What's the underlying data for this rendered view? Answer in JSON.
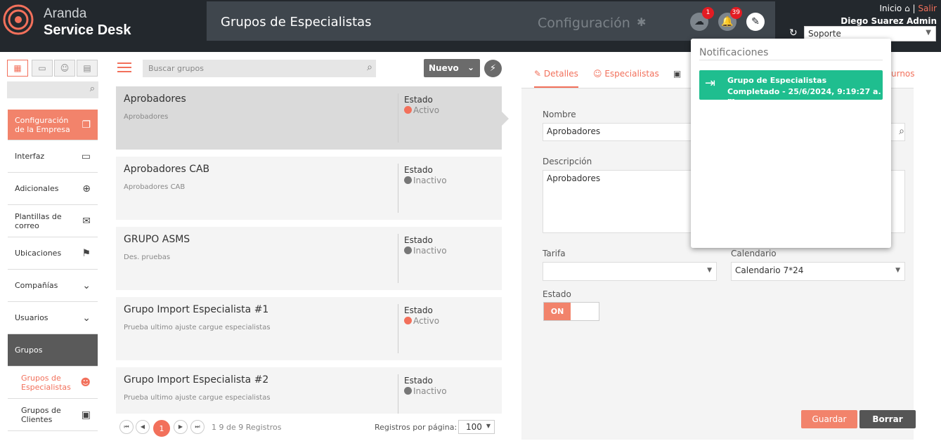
{
  "brand": {
    "line1": "Aranda",
    "line2": "Service Desk"
  },
  "header": {
    "title": "Grupos de Especialistas",
    "config_label": "Configuración",
    "upload_badge": "1",
    "notif_badge": "39"
  },
  "toplinks": {
    "inicio": "Inicio",
    "separator": "|",
    "salir": "Salir",
    "user": "Diego Suarez Admin",
    "project": "Soporte"
  },
  "sidebar": {
    "items": [
      {
        "label": "Configuración de la Empresa"
      },
      {
        "label": "Interfaz"
      },
      {
        "label": "Adicionales"
      },
      {
        "label": "Plantillas de correo"
      },
      {
        "label": "Ubicaciones"
      },
      {
        "label": "Compañías"
      },
      {
        "label": "Usuarios"
      },
      {
        "label": "Grupos"
      },
      {
        "label": "Grupos de Especialistas"
      },
      {
        "label": "Grupos de Clientes"
      }
    ]
  },
  "list": {
    "search_placeholder": "Buscar grupos",
    "new_label": "Nuevo",
    "status_label": "Estado",
    "cards": [
      {
        "name": "Aprobadores",
        "desc": "Aprobadores",
        "state": "Activo"
      },
      {
        "name": "Aprobadores CAB",
        "desc": "Aprobadores CAB",
        "state": "Inactivo"
      },
      {
        "name": "GRUPO ASMS",
        "desc": "Des. pruebas",
        "state": "Inactivo"
      },
      {
        "name": "Grupo Import Especialista #1",
        "desc": "Prueba ultimo ajuste cargue especialistas",
        "state": "Activo"
      },
      {
        "name": "Grupo Import Especialista #2",
        "desc": "Prueba ultimo ajuste cargue especialistas",
        "state": "Inactivo"
      }
    ]
  },
  "pager": {
    "current": "1",
    "range": "1 9 de 9 Registros",
    "per_page_label": "Registros por página:",
    "per_page": "100"
  },
  "detail": {
    "tabs": {
      "detalles": "Detalles",
      "especialistas": "Especialistas",
      "turnos": "urnos"
    },
    "nombre_label": "Nombre",
    "nombre_value": "Aprobadores",
    "descripcion_label": "Descripción",
    "descripcion_value": "Aprobadores",
    "tarifa_label": "Tarifa",
    "tarifa_value": "",
    "calendario_label": "Calendario",
    "calendario_value": "Calendario 7*24",
    "estado_label": "Estado",
    "toggle_on": "ON",
    "save_label": "Guardar",
    "delete_label": "Borrar"
  },
  "notifications": {
    "title": "Notificaciones",
    "items": [
      {
        "line1": "Grupo de Especialistas",
        "line2": "Completado - 25/6/2024, 9:19:27 a. m."
      }
    ]
  },
  "colors": {
    "accent": "#f2705b",
    "success": "#1fbe8f",
    "topbar": "#23282d"
  }
}
